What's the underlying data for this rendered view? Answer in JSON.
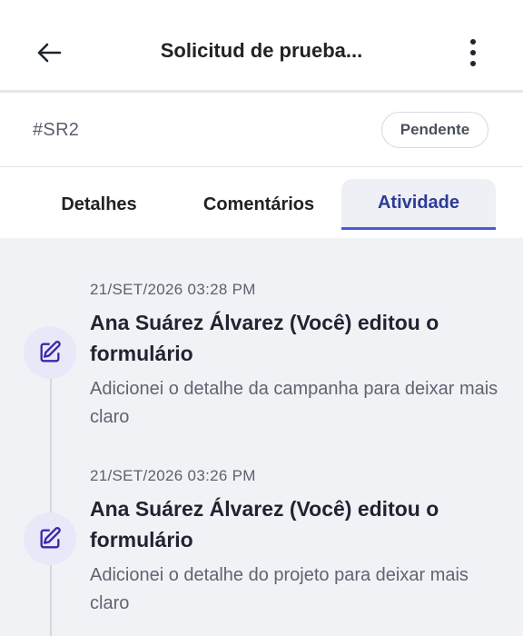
{
  "header": {
    "title": "Solicitud de prueba...",
    "back_icon": "arrow-left-icon",
    "menu_icon": "more-vertical-icon"
  },
  "request": {
    "id": "#SR2",
    "status": "Pendente"
  },
  "tabs": [
    {
      "label": "Detalhes",
      "active": false
    },
    {
      "label": "Comentários",
      "active": false
    },
    {
      "label": "Atividade",
      "active": true
    }
  ],
  "activity": [
    {
      "timestamp": "21/SET/2026 03:28 PM",
      "title": "Ana Suárez Álvarez (Você) editou o formulário",
      "description": "Adicionei o detalhe da campanha para deixar mais claro",
      "icon": "edit-icon"
    },
    {
      "timestamp": "21/SET/2026 03:26 PM",
      "title": "Ana Suárez Álvarez (Você) editou o formulário",
      "description": "Adicionei o detalhe do projeto para deixar mais claro",
      "icon": "edit-icon"
    }
  ],
  "colors": {
    "accent": "#4a5bd4",
    "icon": "#3a2aa8",
    "feed_bg": "#f1f2f6"
  }
}
